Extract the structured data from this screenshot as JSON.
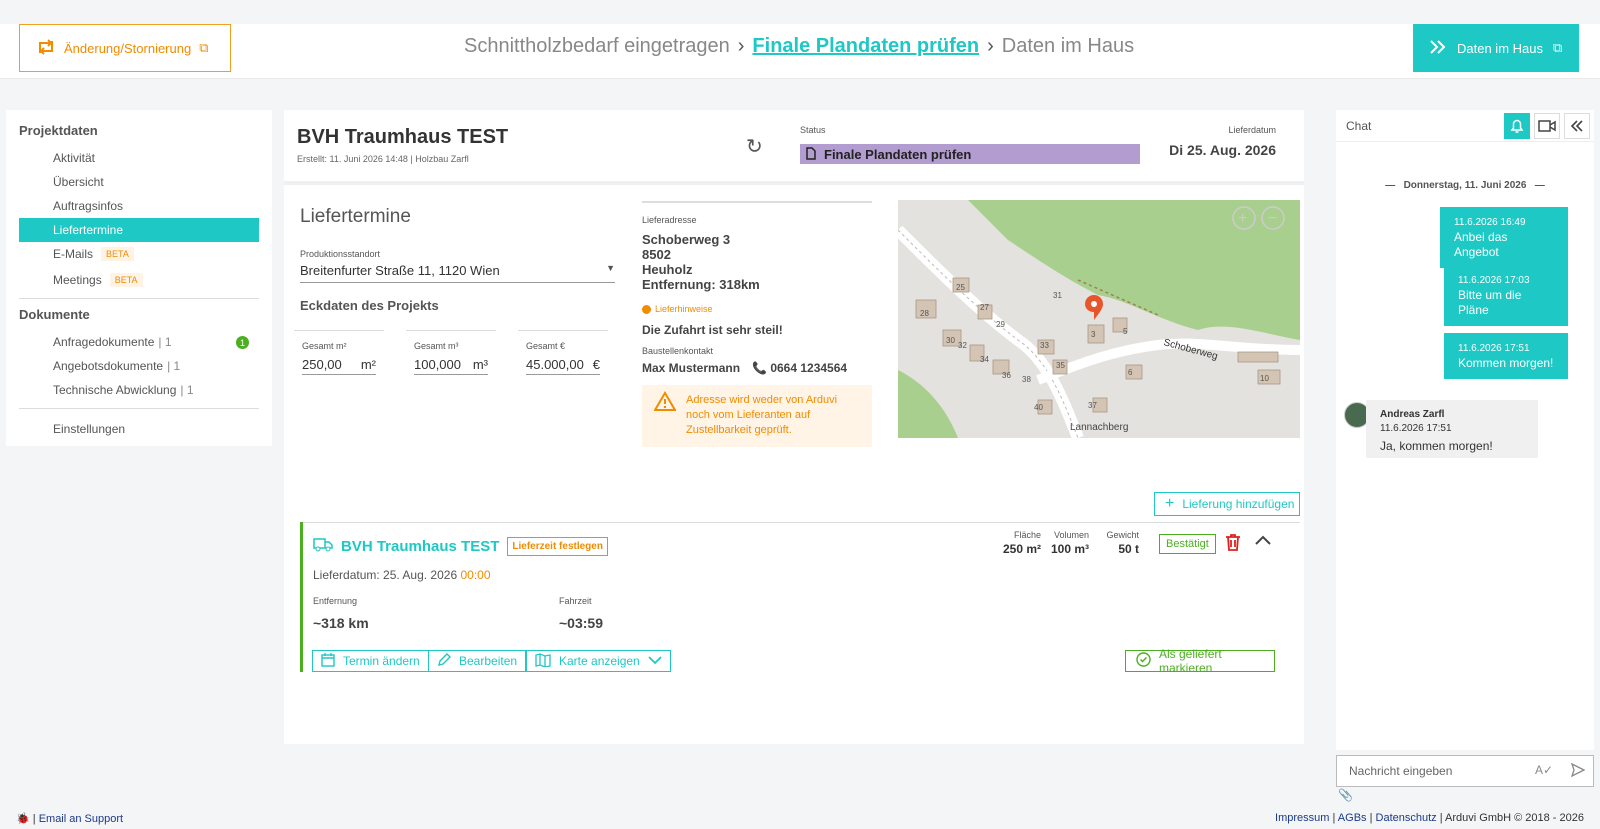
{
  "topbar": {
    "change_label": "Änderung/Stornierung",
    "steps": [
      "Schnittholzbedarf eingetragen",
      "Finale Plandaten prüfen",
      "Daten im Haus"
    ],
    "next_label": "Daten im Haus"
  },
  "sidebar": {
    "projekt_heading": "Projektdaten",
    "items": [
      {
        "label": "Aktivität"
      },
      {
        "label": "Übersicht"
      },
      {
        "label": "Auftragsinfos"
      },
      {
        "label": "Liefertermine"
      },
      {
        "label": "E-Mails",
        "badge": "BETA"
      },
      {
        "label": "Meetings",
        "badge": "BETA"
      }
    ],
    "dokumente_heading": "Dokumente",
    "docs": [
      {
        "label": "Anfragedokumente",
        "count": "| 1",
        "notify": "1"
      },
      {
        "label": "Angebotsdokumente",
        "count": "| 1"
      },
      {
        "label": "Technische Abwicklung",
        "count": "| 1"
      }
    ],
    "settings": "Einstellungen"
  },
  "project": {
    "title": "BVH Traumhaus TEST",
    "created": "Erstellt: 11. Juni 2026 14:48 | Holzbau Zarfl",
    "status_label": "Status",
    "status_value": "Finale Plandaten prüfen",
    "date_label": "Lieferdatum",
    "date_value": "Di 25. Aug. 2026"
  },
  "liefertermine": {
    "title": "Liefertermine",
    "prod_label": "Produktionsstandort",
    "prod_value": "Breitenfurter Straße 11, 1120 Wien",
    "eck_title": "Eckdaten des Projekts",
    "totals": [
      {
        "label": "Gesamt m²",
        "value": "250,00",
        "unit": "m²"
      },
      {
        "label": "Gesamt m³",
        "value": "100,000",
        "unit": "m³"
      },
      {
        "label": "Gesamt €",
        "value": "45.000,00",
        "unit": "€"
      }
    ]
  },
  "address": {
    "label": "Lieferadresse",
    "street": "Schoberweg 3",
    "zip": "8502",
    "city": "Heuholz",
    "distance": "Entfernung: 318km",
    "hint_label": "Lieferhinweise",
    "hint_text": "Die Zufahrt ist sehr steil!",
    "contact_label": "Baustellenkontakt",
    "contact_name": "Max Mustermann",
    "contact_phone": "0664 1234564",
    "warning": "Adresse wird weder von Arduvi noch vom Lieferanten auf Zustellbarkeit geprüft."
  },
  "map": {
    "street_label": "Schoberweg",
    "place_label": "Lannachberg",
    "house_numbers": [
      "25",
      "27",
      "28",
      "29",
      "30",
      "31",
      "32",
      "33",
      "34",
      "35",
      "36",
      "38",
      "40",
      "37",
      "3",
      "5",
      "6",
      "10"
    ]
  },
  "delivery": {
    "add_label": "Lieferung hinzufügen",
    "title": "BVH Traumhaus TEST",
    "chip": "Lieferzeit festlegen",
    "date_label": "Lieferdatum:",
    "date_value": "25. Aug. 2026",
    "time_value": "00:00",
    "dist_label": "Entfernung",
    "dist_value": "~318 km",
    "drive_label": "Fahrzeit",
    "drive_value": "~03:59",
    "area_label": "Fläche",
    "area_value": "250 m²",
    "vol_label": "Volumen",
    "vol_value": "100 m³",
    "weight_label": "Gewicht",
    "weight_value": "50 t",
    "confirmed": "Bestätigt",
    "btn_reschedule": "Termin ändern",
    "btn_edit": "Bearbeiten",
    "btn_map": "Karte anzeigen",
    "btn_delivered": "Als geliefert markieren"
  },
  "chat": {
    "title": "Chat",
    "day": "Donnerstag, 11. Juni 2026",
    "messages": [
      {
        "ts": "11.6.2026 16:49",
        "text": "Anbei das Angebot"
      },
      {
        "ts": "11.6.2026 17:03",
        "text": "Bitte um die Pläne"
      },
      {
        "ts": "11.6.2026 17:51",
        "text": "Kommen morgen!"
      }
    ],
    "incoming": {
      "name": "Andreas Zarfl",
      "ts": "11.6.2026 17:51",
      "text": "Ja, kommen morgen!"
    },
    "input_placeholder": "Nachricht eingeben"
  },
  "footer": {
    "support": "Email an Support",
    "impressum": "Impressum",
    "agbs": "AGBs",
    "datenschutz": "Datenschutz",
    "copyright": "Arduvi GmbH © 2018 - 2026"
  },
  "colors": {
    "accent": "#1ec8c4",
    "warning": "#f08c00",
    "success": "#4caf20",
    "status": "#b39cd0"
  }
}
